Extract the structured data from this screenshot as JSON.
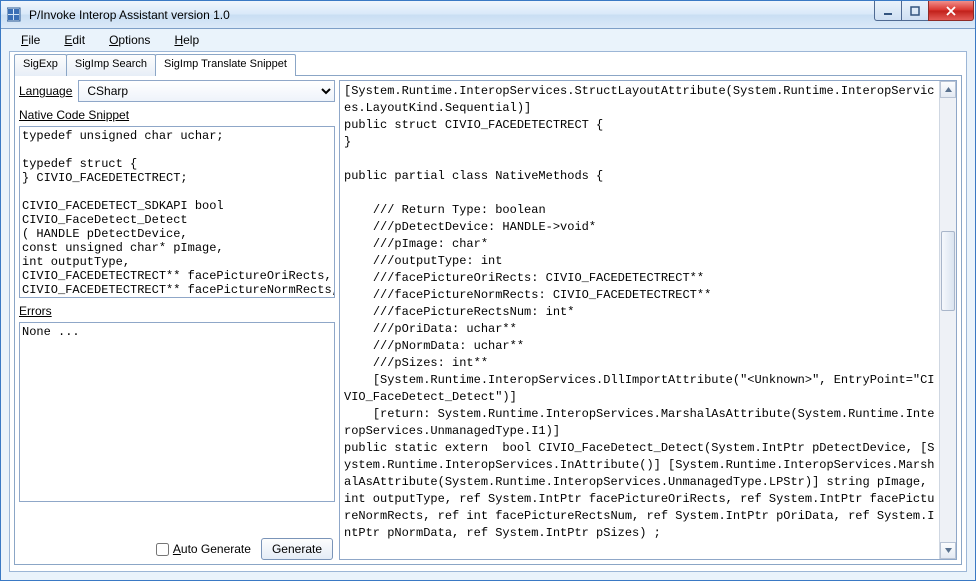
{
  "window": {
    "title": "P/Invoke Interop Assistant version 1.0"
  },
  "menu": {
    "file": "File",
    "edit": "Edit",
    "options": "Options",
    "help": "Help"
  },
  "tabs": {
    "sigexp": "SigExp",
    "sigimp_search": "SigImp Search",
    "sigimp_translate": "SigImp Translate Snippet"
  },
  "left": {
    "language_label": "Language",
    "language_value": "CSharp",
    "native_label": "Native Code Snippet",
    "native_code": "typedef unsigned char uchar;\n\ntypedef struct {\n} CIVIO_FACEDETECTRECT;\n\nCIVIO_FACEDETECT_SDKAPI bool\nCIVIO_FaceDetect_Detect\n( HANDLE pDetectDevice,\nconst unsigned char* pImage,\nint outputType,\nCIVIO_FACEDETECTRECT** facePictureOriRects,\nCIVIO_FACEDETECTRECT** facePictureNormRects,\nint* facePictureRectsNum,\nuchar** pOriData,",
    "errors_label": "Errors",
    "errors_text": "None ...",
    "auto_generate_label": "Auto Generate",
    "generate_label": "Generate"
  },
  "output": "[System.Runtime.InteropServices.StructLayoutAttribute(System.Runtime.InteropServices.LayoutKind.Sequential)]\npublic struct CIVIO_FACEDETECTRECT {\n}\n\npublic partial class NativeMethods {\n\n    /// Return Type: boolean\n    ///pDetectDevice: HANDLE->void*\n    ///pImage: char*\n    ///outputType: int\n    ///facePictureOriRects: CIVIO_FACEDETECTRECT**\n    ///facePictureNormRects: CIVIO_FACEDETECTRECT**\n    ///facePictureRectsNum: int*\n    ///pOriData: uchar**\n    ///pNormData: uchar**\n    ///pSizes: int**\n    [System.Runtime.InteropServices.DllImportAttribute(\"<Unknown>\", EntryPoint=\"CIVIO_FaceDetect_Detect\")]\n    [return: System.Runtime.InteropServices.MarshalAsAttribute(System.Runtime.InteropServices.UnmanagedType.I1)]\npublic static extern  bool CIVIO_FaceDetect_Detect(System.IntPtr pDetectDevice, [System.Runtime.InteropServices.InAttribute()] [System.Runtime.InteropServices.MarshalAsAttribute(System.Runtime.InteropServices.UnmanagedType.LPStr)] string pImage, int outputType, ref System.IntPtr facePictureOriRects, ref System.IntPtr facePictureNormRects, ref int facePictureRectsNum, ref System.IntPtr pOriData, ref System.IntPtr pNormData, ref System.IntPtr pSizes) ;\n"
}
